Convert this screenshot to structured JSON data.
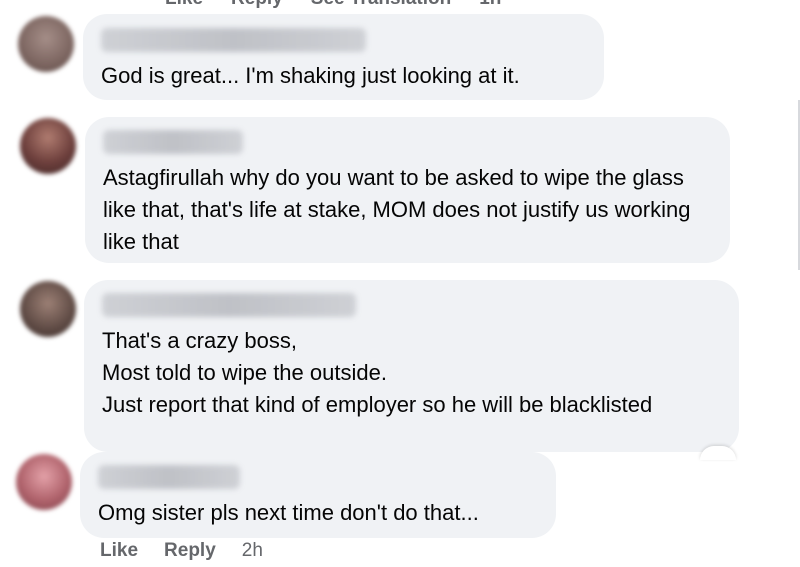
{
  "top_actions": [
    "Like",
    "Reply",
    "See Translation",
    "1h"
  ],
  "comments": [
    {
      "avatar_color": "#8a6f6a",
      "text": "God is great... I'm shaking just looking at it."
    },
    {
      "avatar_color": "#7a4a4a",
      "text": "Astagfirullah why do you want to be asked to wipe the glass like that, that's life at stake, MOM does not justify us working like that"
    },
    {
      "avatar_color": "#6b5a52",
      "text": "That's a crazy boss,\nMost told to wipe the outside.\nJust report that kind of employer so he will be blacklisted"
    },
    {
      "avatar_color": "#b06a73",
      "text": "Omg sister pls next time don't do that..."
    }
  ],
  "comment_actions": {
    "like": "Like",
    "reply": "Reply",
    "time": "2h"
  }
}
